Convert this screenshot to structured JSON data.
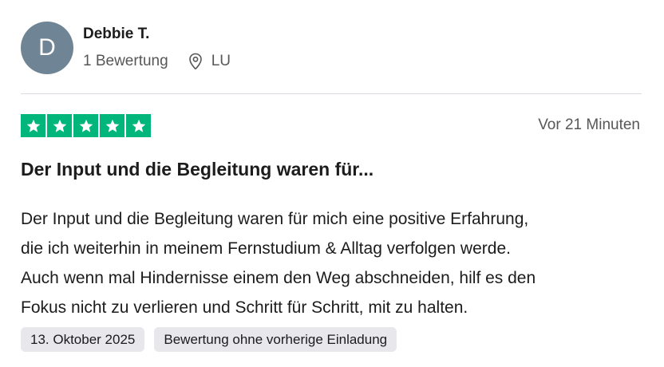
{
  "reviewer": {
    "avatar_initial": "D",
    "name": "Debbie T.",
    "review_count": "1 Bewertung",
    "location": "LU"
  },
  "review": {
    "rating": 5,
    "rating_max": 5,
    "timestamp": "Vor 21 Minuten",
    "title": "Der Input und die Begleitung waren für...",
    "body_lines": [
      "Der Input und die Begleitung waren für mich eine positive Erfahrung,",
      "die ich weiterhin in meinem Fernstudium & Alltag verfolgen werde.",
      "Auch wenn mal Hindernisse einem den Weg abschneiden, hilf es den",
      "Fokus nicht zu verlieren und Schritt für Schritt, mit zu halten."
    ],
    "tags": [
      "13. Oktober 2025",
      "Bewertung ohne vorherige Einladung"
    ]
  },
  "icons": {
    "location": "map-pin-icon",
    "star": "star-icon"
  },
  "colors": {
    "star_green": "#00b67a",
    "avatar_bg": "#6f8494",
    "tag_bg": "#e7e7ec"
  }
}
